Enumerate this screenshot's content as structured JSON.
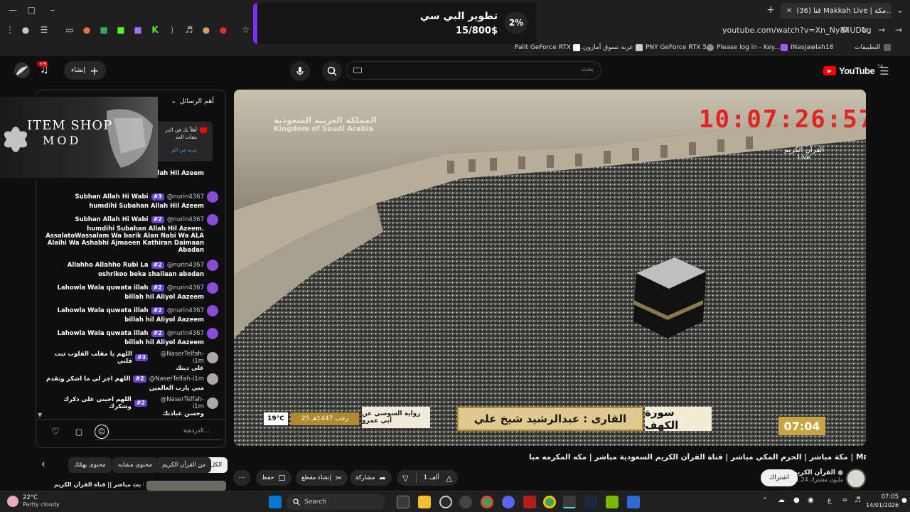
{
  "browser": {
    "tab_title": "(36) قنا Makkah Live | مكة...",
    "url": "youtube.com/watch?v=Xn_Ny84UDeg"
  },
  "bookmarks": [
    {
      "label": "التطبيقات",
      "color": "#5f6368"
    },
    {
      "label": "INasJawlah18",
      "color": "#a855f7"
    },
    {
      "label": "Please log in - Key...",
      "color": "#888888"
    },
    {
      "label": "PNY GeForce RTX 5...",
      "color": "#cccccc"
    },
    {
      "label": "عربة تسوق أمازون",
      "color": "#ffffff"
    },
    {
      "label": "Palit GeForce RTX 5...",
      "color": "#cccccc"
    }
  ],
  "popup": {
    "percent": "2%",
    "title": "تطوير البي سي",
    "amount": "15/800$"
  },
  "youtube": {
    "logo": "YouTube",
    "region": "SA",
    "search_placeholder": "بحث",
    "create_label": "إنشاء",
    "notif_count": "+9"
  },
  "chat": {
    "header": "أهم الرسائل",
    "pinned_line1": "أهلاً بك في الدر",
    "pinned_line2": "بتقات المد",
    "pinned_more": "مزيد من الم",
    "input_placeholder": "الدردشة...",
    "messages": [
      {
        "name": "",
        "badge": "",
        "text": "humdihi Subahan Allah Hil Azeem",
        "prefix": ""
      },
      {
        "name": "@nurin4367",
        "badge": "#3",
        "prefix": "Subhan Allah Hi Wabi",
        "text": "humdihi Subahan Allah Hil Azeem"
      },
      {
        "name": "@nurin4367",
        "badge": "#2",
        "prefix": "Subhan Allah Hi Wabi",
        "text": "humdihi Subahan Allah Hil Azeem. AssalatoWassalam Wa barik Alan Nabi Wa ALA Alaihi Wa Ashabhi Ajmaeen Kathiran Daimaan Abadan"
      },
      {
        "name": "@nurin4367",
        "badge": "#2",
        "prefix": "Allahho Allahho Rubi La",
        "text": "oshrikoo beka shailaan abadan"
      },
      {
        "name": "@nurin4367",
        "badge": "#2",
        "prefix": "Lahowla Wala quwata illah",
        "text": "billah hil Aliyol Aazeem"
      },
      {
        "name": "@nurin4367",
        "badge": "#2",
        "prefix": "Lahowla Wala quwata illah",
        "text": "billah hil Aliyol Aazeem"
      },
      {
        "name": "@nurin4367",
        "badge": "#2",
        "prefix": "Lahowla Wala quwata illah",
        "text": "billah hil Aliyol Aazeem"
      },
      {
        "name": "@NaserTelfah-i1m",
        "badge": "#3",
        "prefix": "اللهم يا مقلب القلوب ثبت قلبي",
        "text": "على دينك"
      },
      {
        "name": "@NaserTelfah-i1m",
        "badge": "#2",
        "prefix": "اللهم اجر لي ما اشكر وتقدم",
        "text": "مني يارب العالمين"
      },
      {
        "name": "@NaserTelfah-i1m",
        "badge": "#2",
        "prefix": "اللهم احيني على ذكرك وشكرك",
        "text": "وحسن عبادتك"
      }
    ]
  },
  "item_shop": {
    "line1": "ITEM SHOP",
    "line2": "MOD"
  },
  "video": {
    "clock": "10:07:26:57",
    "channel_brand": "القرآن الكريم",
    "live_label": "Live",
    "watermark_ar": "المملكة العربية السعودية",
    "watermark_en": "Kingdom of Saudi Arabia",
    "surah": "سورة الكهف",
    "reciter": "القارى : عبدالرشيد شيخ علي",
    "riwaya": "رواية السوسي عن أبي عمرو",
    "hijri_date": "25 رجب 1447هـ",
    "temp": "19°C",
    "time": "07:04"
  },
  "video_info": {
    "title": "مكة مباشر | الحرم المكي مباشر | قناة القرآن الكريم السعودية مباشر | مكه المكرمه مبا | Makkah Live",
    "channel": "القرآن الكريم",
    "subs": "1.24 مليون مشترك",
    "subscribe": "اشتراك",
    "likes": "1 ألف",
    "share": "مشاركة",
    "clip": "إنشاء مقطع",
    "save": "حفظ"
  },
  "chips": {
    "all": "الكل",
    "from_channel": "من القرآن الكريم",
    "similar": "محتوى مشابه",
    "for_you": "محتوى يهمّك"
  },
  "related": {
    "title": "بث مباشر || قناة القرآن الكريم Makkah"
  },
  "taskbar": {
    "weather_temp": "22°C",
    "weather_desc": "Partly cloudy",
    "search_label": "Search",
    "time": "07:05",
    "date": "14/01/2026",
    "lang": "ع"
  }
}
